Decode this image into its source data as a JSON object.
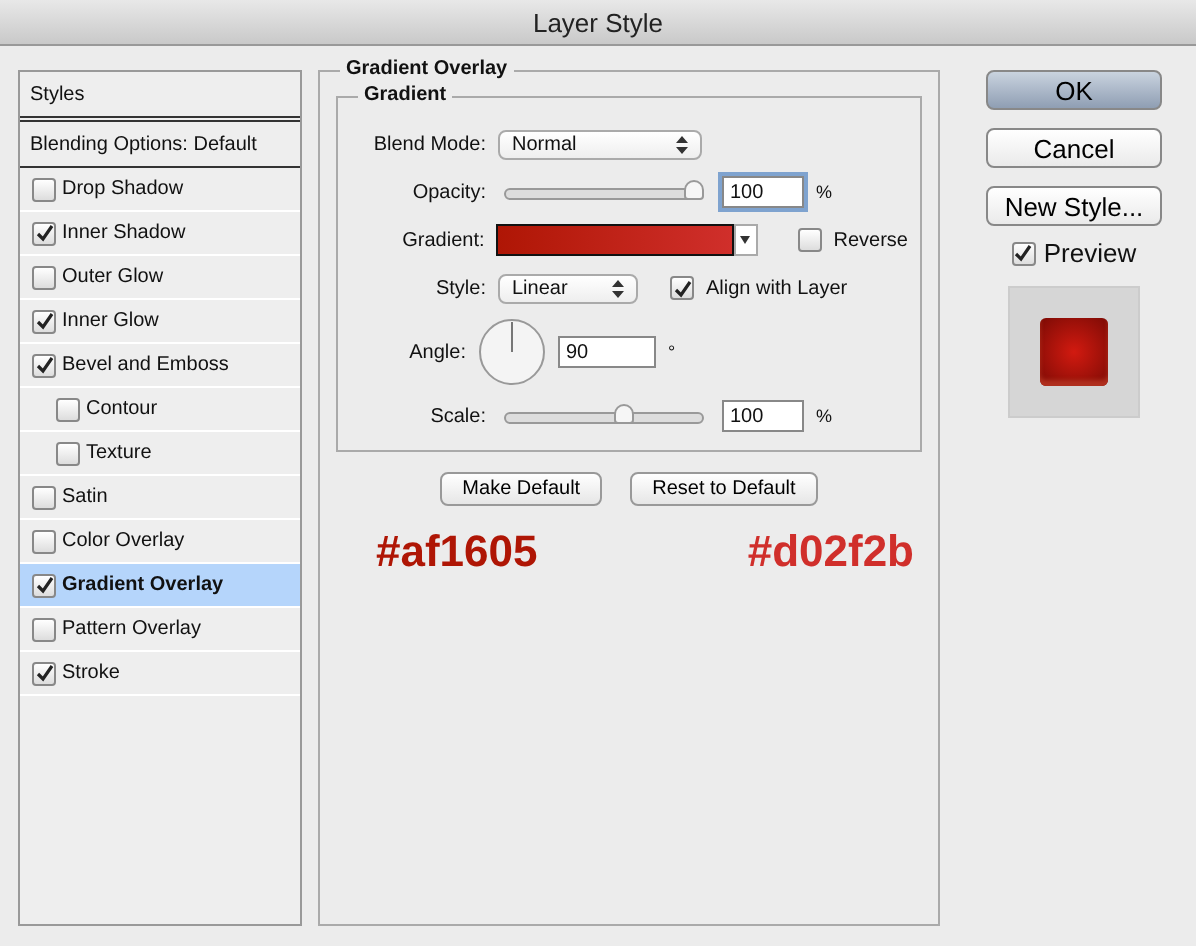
{
  "window": {
    "title": "Layer Style"
  },
  "sidebar": {
    "header": "Styles",
    "blending": "Blending Options: Default",
    "items": [
      {
        "label": "Drop Shadow",
        "checked": false,
        "selected": false
      },
      {
        "label": "Inner Shadow",
        "checked": true,
        "selected": false
      },
      {
        "label": "Outer Glow",
        "checked": false,
        "selected": false
      },
      {
        "label": "Inner Glow",
        "checked": true,
        "selected": false
      },
      {
        "label": "Bevel and Emboss",
        "checked": true,
        "selected": false,
        "children": [
          {
            "label": "Contour",
            "checked": false,
            "selected": false
          },
          {
            "label": "Texture",
            "checked": false,
            "selected": false
          }
        ]
      },
      {
        "label": "Satin",
        "checked": false,
        "selected": false
      },
      {
        "label": "Color Overlay",
        "checked": false,
        "selected": false
      },
      {
        "label": "Gradient Overlay",
        "checked": true,
        "selected": true
      },
      {
        "label": "Pattern Overlay",
        "checked": false,
        "selected": false
      },
      {
        "label": "Stroke",
        "checked": true,
        "selected": false
      }
    ]
  },
  "panel": {
    "title": "Gradient Overlay",
    "group": "Gradient",
    "blend_mode": {
      "label": "Blend Mode:",
      "value": "Normal"
    },
    "opacity": {
      "label": "Opacity:",
      "level": 0.97,
      "value": "100",
      "unit": "%"
    },
    "gradient": {
      "label": "Gradient:",
      "reverse": {
        "label": "Reverse",
        "checked": false
      }
    },
    "style": {
      "label": "Style:",
      "value": "Linear",
      "align": {
        "label": "Align with Layer",
        "checked": true
      }
    },
    "angle": {
      "label": "Angle:",
      "value": "90",
      "unit": "°"
    },
    "scale": {
      "label": "Scale:",
      "level": 0.6,
      "value": "100",
      "unit": "%"
    },
    "buttons": [
      "Make Default",
      "Reset to Default"
    ],
    "colors": [
      {
        "text": "#af1605",
        "color": "#af1605"
      },
      {
        "text": "#d02f2b",
        "color": "#d02f2b"
      }
    ]
  },
  "actions": [
    {
      "label": "OK",
      "kind": "default"
    },
    {
      "label": "Cancel",
      "kind": "plain"
    },
    {
      "label": "New Style...",
      "kind": "plain"
    }
  ],
  "preview": {
    "label": "Preview",
    "checked": true
  }
}
